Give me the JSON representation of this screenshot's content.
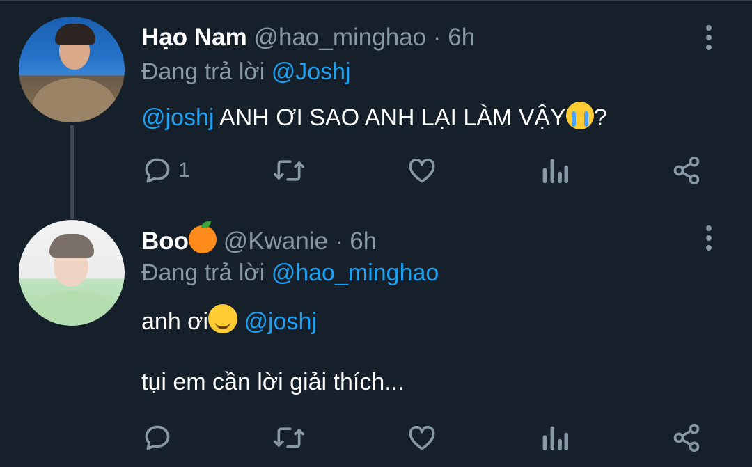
{
  "tweets": [
    {
      "name": "Hạo Nam",
      "handle": "@hao_minghao",
      "separator": "·",
      "time": "6h",
      "reply_prefix": "Đang trả lời",
      "reply_to": "@Joshj",
      "mention": "@joshj",
      "text": "ANH ƠI SAO ANH LẠI LÀM VẬY",
      "text_emoji": "loudly-crying-face",
      "text_suffix": "?",
      "reply_count": "1"
    },
    {
      "name": "Boo",
      "name_emoji": "tangerine",
      "handle": "@Kwanie",
      "separator": "·",
      "time": "6h",
      "reply_prefix": "Đang trả lời",
      "reply_to": "@hao_minghao",
      "text": "anh ơi",
      "text_emoji": "smiling-face-with-smiling-eyes",
      "mention": "@joshj",
      "text2": "tụi em cần lời giải thích..."
    }
  ],
  "icons": [
    "reply-icon",
    "retweet-icon",
    "like-icon",
    "analytics-icon",
    "share-icon",
    "more-icon"
  ],
  "colors": {
    "background": "#15202b",
    "accent": "#1da1f2",
    "secondary_text": "#8899a6"
  }
}
